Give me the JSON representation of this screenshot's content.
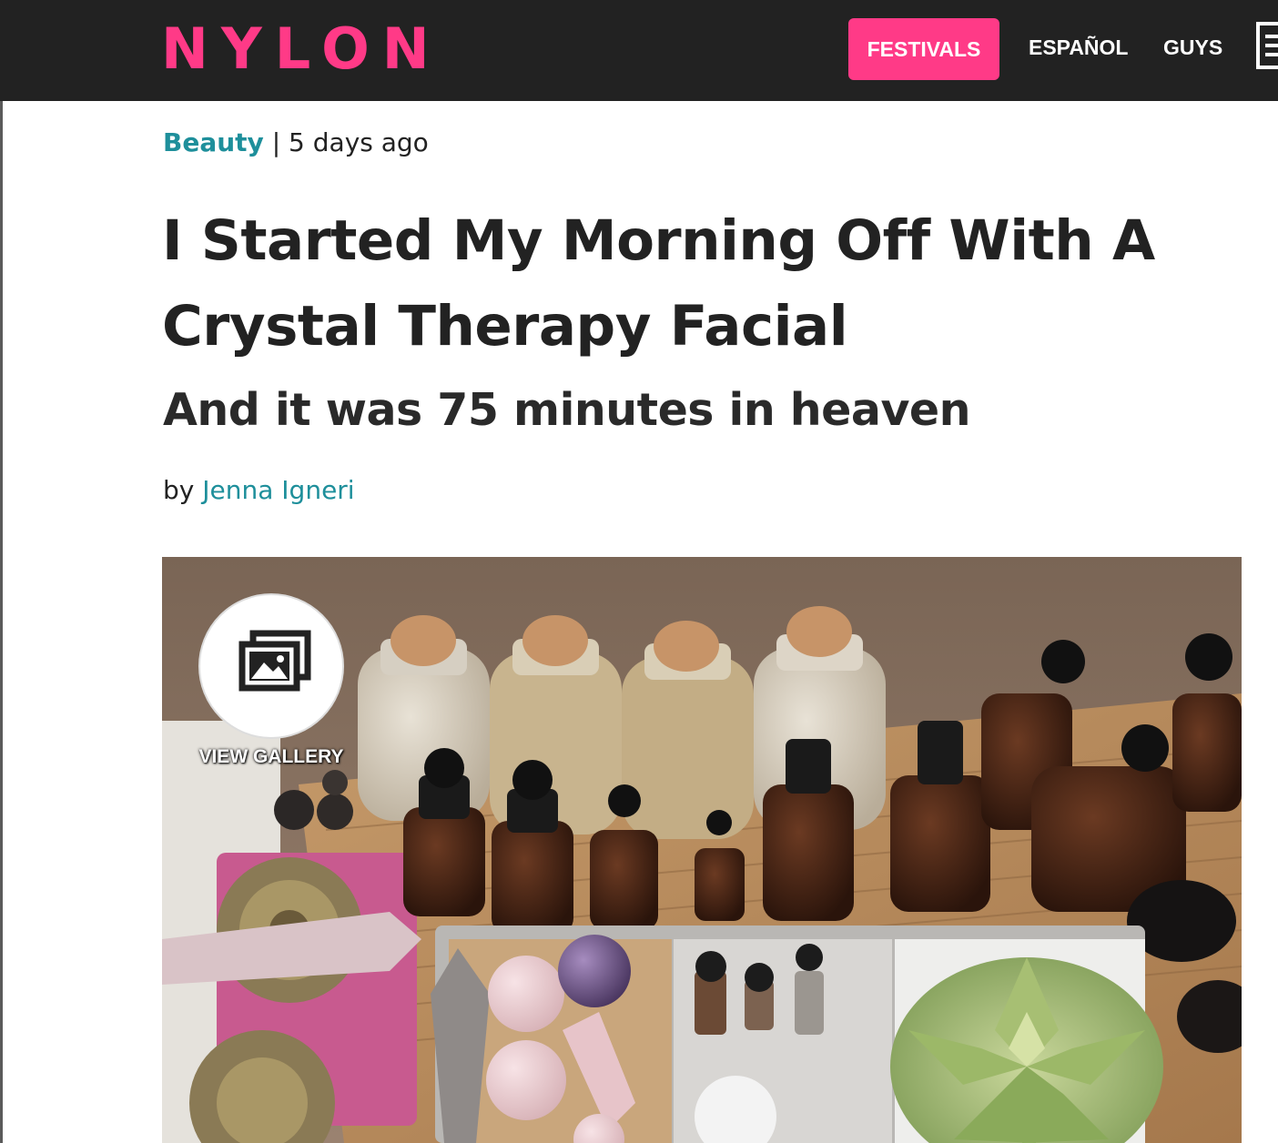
{
  "header": {
    "logo": "NYLON",
    "nav": {
      "festivals": "FESTIVALS",
      "espanol": "ESPAÑOL",
      "guys": "GUYS"
    },
    "accent_color": "#ff3a87",
    "background_color": "#222222"
  },
  "article": {
    "category": "Beauty",
    "separator": "|",
    "date": "5 days ago",
    "title_line1": "I Started My Morning Off With A",
    "title_line2": "Crystal Therapy Facial",
    "subtitle": "And it was 75 minutes in heaven",
    "byline_prefix": "by",
    "author": "Jenna Igneri",
    "link_color": "#1e8f9b"
  },
  "hero": {
    "gallery_label": "VIEW GALLERY",
    "gallery_icon": "gallery-icon"
  }
}
